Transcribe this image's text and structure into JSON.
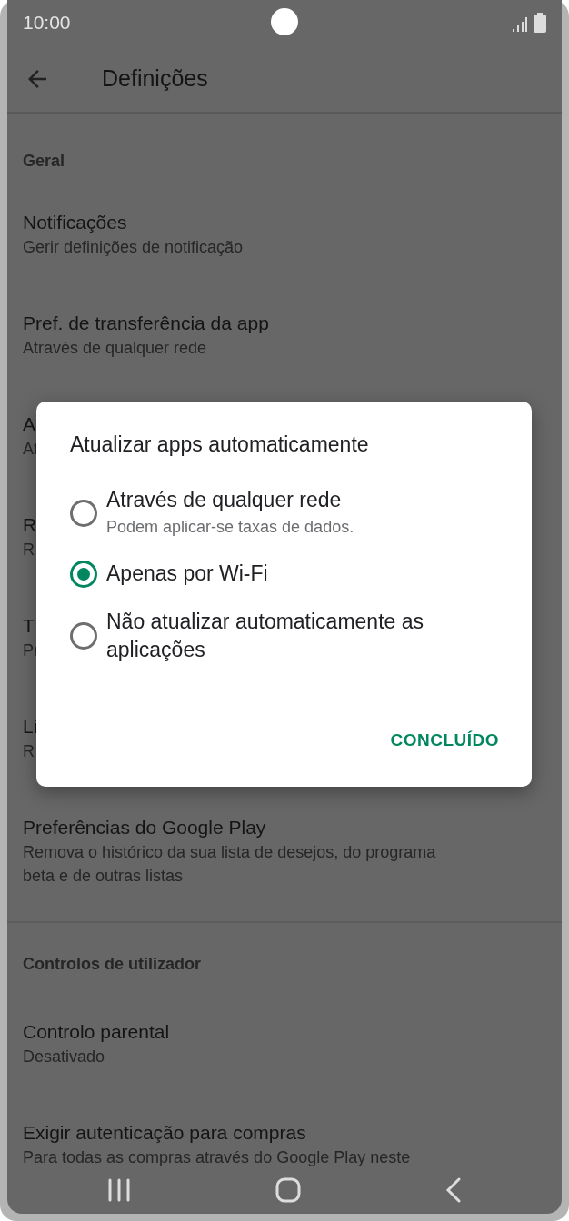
{
  "status_bar": {
    "time": "10:00"
  },
  "header": {
    "title": "Definições"
  },
  "sections": [
    {
      "heading": "Geral",
      "items": [
        {
          "title": "Notificações",
          "subtitle": [
            "Gerir definições de notificação"
          ]
        },
        {
          "title": "Pref. de transferência da app",
          "subtitle": [
            "Através de qualquer rede"
          ]
        },
        {
          "title": "A",
          "subtitle": [
            "At"
          ]
        },
        {
          "title": "R",
          "subtitle": [
            "R"
          ]
        },
        {
          "title": "T",
          "subtitle": [
            "Pr"
          ]
        },
        {
          "title": "Li",
          "subtitle": [
            "R"
          ]
        },
        {
          "title": "Preferências do Google Play",
          "subtitle": [
            "Remova o histórico da sua lista de desejos, do programa",
            "beta e de outras listas"
          ]
        }
      ]
    },
    {
      "heading": "Controlos de utilizador",
      "items": [
        {
          "title": "Controlo parental",
          "subtitle": [
            "Desativado"
          ]
        },
        {
          "title": "Exigir autenticação para compras",
          "subtitle": [
            "Para todas as compras através do Google Play neste"
          ]
        }
      ]
    }
  ],
  "dialog": {
    "title": "Atualizar apps automaticamente",
    "options": [
      {
        "label": "Através de qualquer rede",
        "description": "Podem aplicar-se taxas de dados.",
        "selected": false
      },
      {
        "label": "Apenas por Wi-Fi",
        "selected": true
      },
      {
        "label": "Não atualizar automaticamente as aplicações",
        "selected": false
      }
    ],
    "button": "CONCLUÍDO"
  }
}
